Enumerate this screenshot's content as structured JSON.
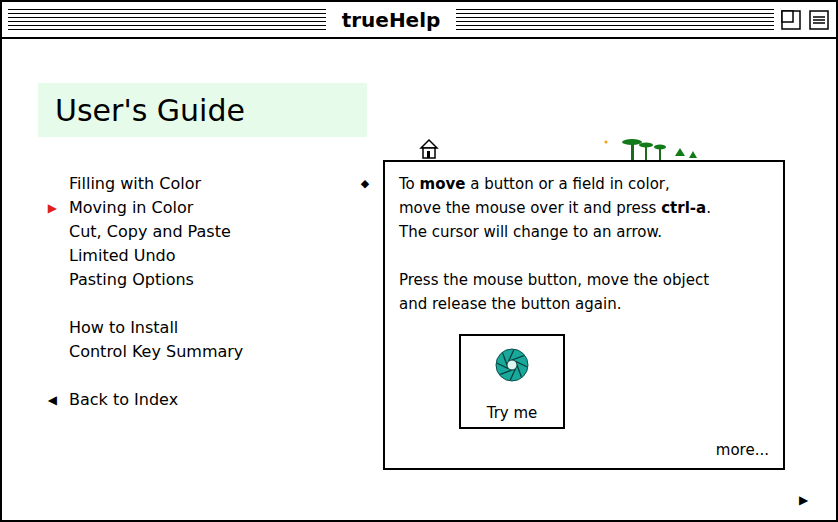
{
  "window": {
    "title": "trueHelp"
  },
  "header": {
    "title": "User's Guide"
  },
  "menu": {
    "marker": "▶",
    "groups": [
      [
        {
          "label": "Filling with Color",
          "selected": false
        },
        {
          "label": "Moving in Color",
          "selected": true
        },
        {
          "label": "Cut, Copy and Paste",
          "selected": false
        },
        {
          "label": "Limited Undo",
          "selected": false
        },
        {
          "label": "Pasting Options",
          "selected": false
        }
      ],
      [
        {
          "label": "How to Install",
          "selected": false
        },
        {
          "label": "Control Key Summary",
          "selected": false
        }
      ]
    ]
  },
  "back": {
    "icon": "◀",
    "label": "Back to Index"
  },
  "panel": {
    "bullet": "◆",
    "paragraphs": [
      [
        [
          {
            "text": "To ",
            "bold": false
          },
          {
            "text": "move",
            "bold": true
          },
          {
            "text": " a button or a field in color,",
            "bold": false
          }
        ],
        [
          {
            "text": "move the mouse over it and press ",
            "bold": false
          },
          {
            "text": "ctrl-a",
            "bold": true
          },
          {
            "text": ".",
            "bold": false
          }
        ],
        [
          {
            "text": "The cursor will change to an arrow.",
            "bold": false
          }
        ]
      ],
      [
        [
          {
            "text": "Press the mouse button, move the object",
            "bold": false
          }
        ],
        [
          {
            "text": "and release the button again.",
            "bold": false
          }
        ]
      ]
    ],
    "try_button": {
      "label": "Try me"
    },
    "more": {
      "label": "more...",
      "icon": "▶"
    }
  }
}
